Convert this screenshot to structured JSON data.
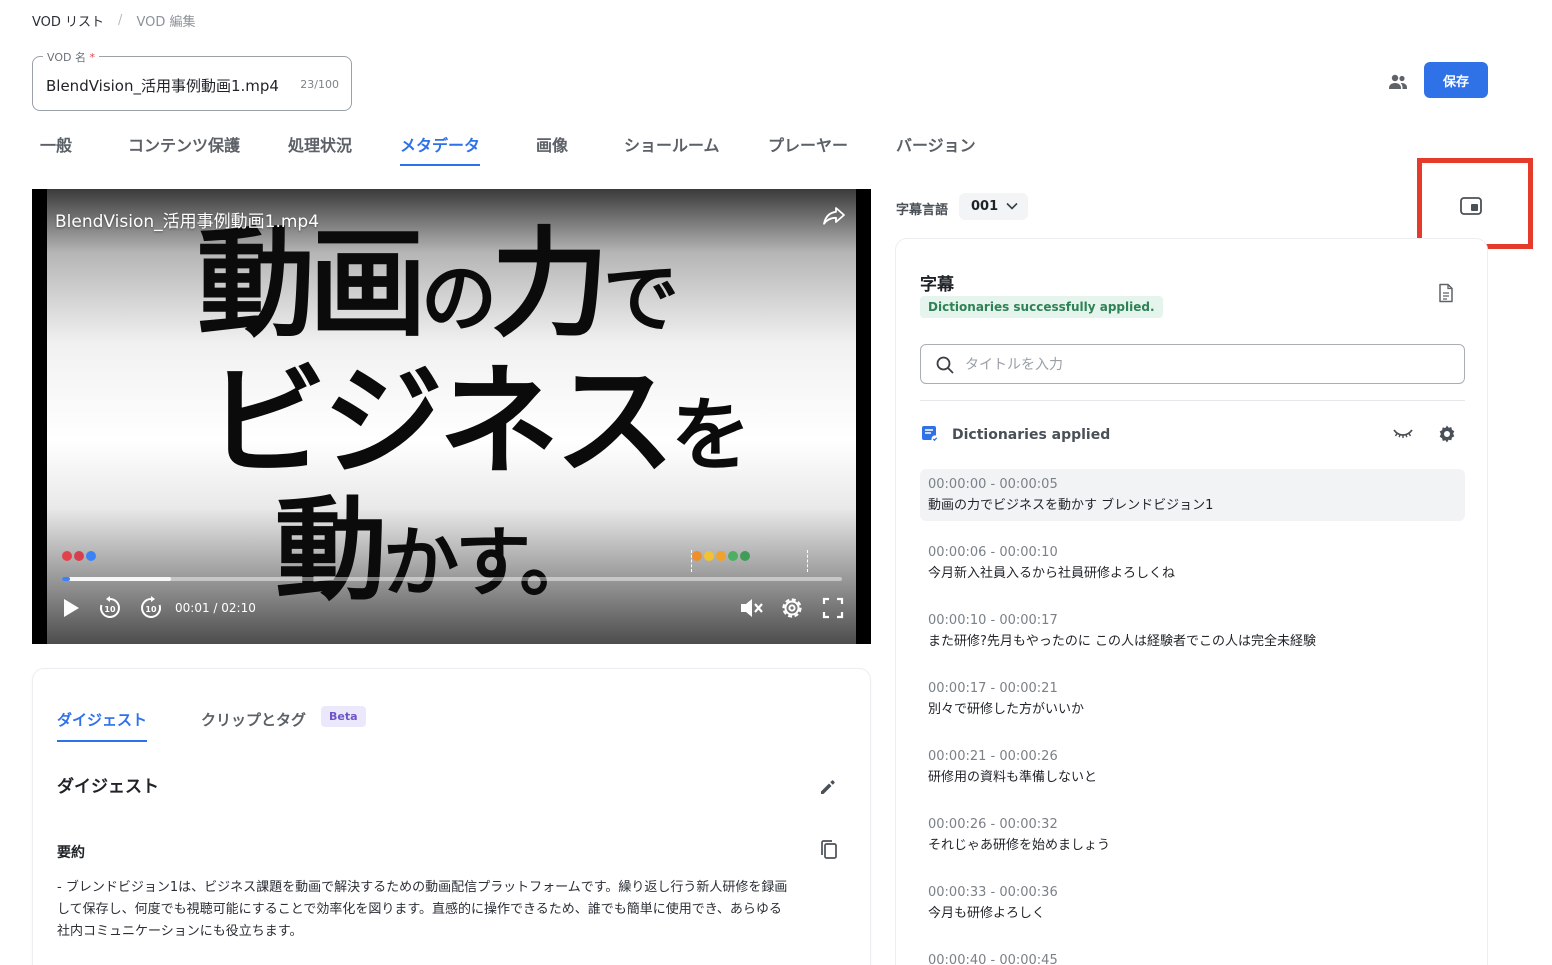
{
  "breadcrumb": {
    "root": "VOD リスト",
    "separator": "/",
    "current": "VOD 編集"
  },
  "vod_name": {
    "label": "VOD 名",
    "required_mark": "*",
    "value": "BlendVision_活用事例動画1.mp4",
    "counter": "23/100"
  },
  "header": {
    "save_label": "保存"
  },
  "tabs": [
    {
      "label": "一般"
    },
    {
      "label": "コンテンツ保護"
    },
    {
      "label": "処理状況"
    },
    {
      "label": "メタデータ",
      "active": true
    },
    {
      "label": "画像"
    },
    {
      "label": "ショールーム"
    },
    {
      "label": "プレーヤー"
    },
    {
      "label": "バージョン"
    }
  ],
  "player": {
    "title": "BlendVision_活用事例動画1.mp4",
    "headline": {
      "line1_a": "動画",
      "line1_b": "の",
      "line1_c": "力",
      "line1_d": "で",
      "line2_a": "ビジネス",
      "line2_b": "を",
      "line3_a": "動",
      "line3_b": "かす。"
    },
    "time": "00:01 / 02:10",
    "progress": 0.008,
    "buffered": 0.14,
    "marker_colors_left": [
      "#e2434a",
      "#d6404e",
      "#3b82f6"
    ],
    "marker_colors_right": [
      "#ef8f2a",
      "#f2c230",
      "#f0a22b",
      "#4caf64",
      "#3f9d58"
    ]
  },
  "digest": {
    "tabs": [
      {
        "label": "ダイジェスト",
        "active": true
      },
      {
        "label": "クリップとタグ"
      }
    ],
    "beta_badge": "Beta",
    "title": "ダイジェスト",
    "summary_title": "要約",
    "summary_lines": [
      "- ブレンドビジョン1は、ビジネス課題を動画で解決するための動画配信プラットフォームです。繰り返し行う新人研修を録画",
      "して保存し、何度でも視聴可能にすることで効率化を図ります。直感的に操作できるため、誰でも簡単に使用でき、あらゆる",
      "社内コミュニケーションにも役立ちます。"
    ]
  },
  "subtitles": {
    "language_label": "字幕言語",
    "language_value": "001",
    "panel_title": "字幕",
    "status_badge": "Dictionaries successfully applied.",
    "search_placeholder": "タイトルを入力",
    "dictionary_label": "Dictionaries applied",
    "cues": [
      {
        "time": "00:00:00 - 00:00:05",
        "text": "動画の力でビジネスを動かす ブレンドビジョン1",
        "active": true
      },
      {
        "time": "00:00:06 - 00:00:10",
        "text": "今月新入社員入るから社員研修よろしくね"
      },
      {
        "time": "00:00:10 - 00:00:17",
        "text": "また研修?先月もやったのに この人は経験者でこの人は完全未経験"
      },
      {
        "time": "00:00:17 - 00:00:21",
        "text": "別々で研修した方がいいか"
      },
      {
        "time": "00:00:21 - 00:00:26",
        "text": "研修用の資料も準備しないと"
      },
      {
        "time": "00:00:26 - 00:00:32",
        "text": "それじゃあ研修を始めましょう"
      },
      {
        "time": "00:00:33 - 00:00:36",
        "text": "今月も研修よろしく"
      },
      {
        "time": "00:00:40 - 00:00:45",
        "text": ""
      }
    ]
  },
  "icons": {
    "user": "users-icon",
    "share": "share-icon",
    "play": "play-icon",
    "rewind": "rewind-10-icon",
    "forward": "forward-10-icon",
    "mute": "volume-mute-icon",
    "settings": "gear-icon",
    "fullscreen": "fullscreen-icon",
    "edit": "pencil-icon",
    "copy": "copy-icon",
    "document": "document-icon",
    "search": "search-icon",
    "dictionary": "dictionary-icon",
    "eye": "eye-closed-icon",
    "layout": "layout-toggle-icon"
  },
  "colors": {
    "accent": "#2f72e8",
    "highlight": "#e43b2b",
    "success_bg": "#e5f4ec",
    "success_text": "#2e8255",
    "beta_bg": "#ece8fb",
    "beta_text": "#6d55c9"
  }
}
